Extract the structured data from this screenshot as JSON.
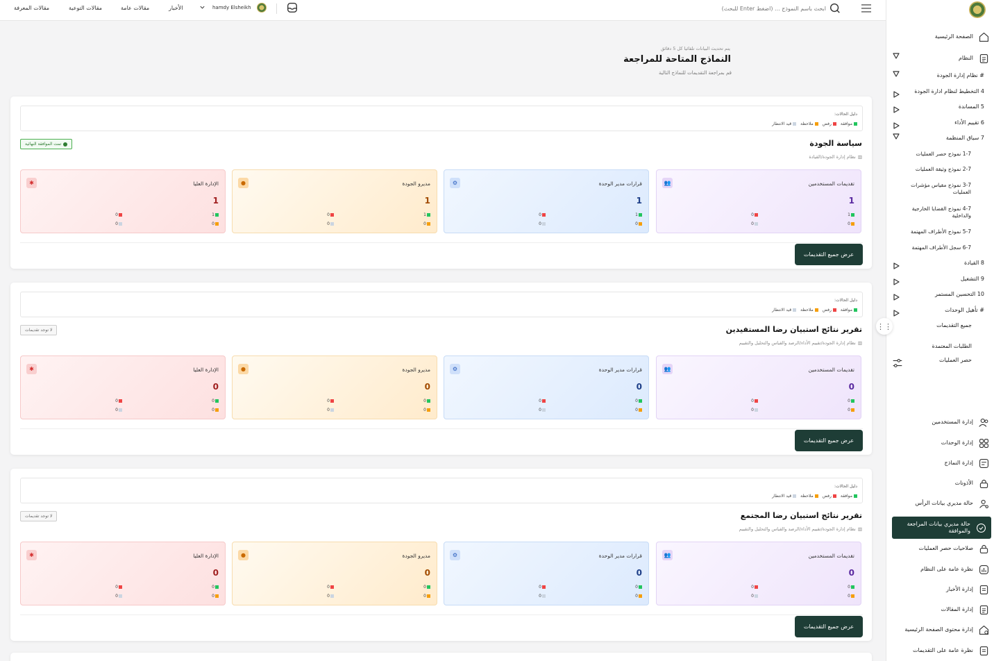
{
  "topbar": {
    "links": [
      "مقالات المعرفة",
      "مقالات التوعية",
      "مقالات عامة",
      "الأخبار"
    ],
    "user_name": "hamdy Elsheikh",
    "search_placeholder": "ابحث باسم النموذج ... (اضغط Enter للبحث)"
  },
  "header": {
    "update_note": "يتم تحديث البيانات تلقائيا كل 5 دقائق",
    "title": "النماذج المتاحة للمراجعة",
    "subtitle": "قم بمراجعة التقديمات للنماذج التالية"
  },
  "legend": {
    "title": "دليل الحالات:",
    "items": [
      {
        "label": "موافقة",
        "color": "#22c55e"
      },
      {
        "label": "رفض",
        "color": "#ef4444"
      },
      {
        "label": "ملاحظة",
        "color": "#f59e0b"
      },
      {
        "label": "قيد الانتظار",
        "color": "#cbd5e1"
      }
    ]
  },
  "tile_labels": [
    "تقديمات المستخدمين",
    "قرارات مدير الوحدة",
    "مديرو الجودة",
    "الإدارة العليا"
  ],
  "button_label": "عرض جميع التقديمات",
  "cards": [
    {
      "title": "سياسة الجودة",
      "path": "نظام إدارة الجودة/القيادة",
      "badge": "تمت الموافقة النهائية",
      "badge_type": "ok",
      "tiles": [
        {
          "value": "1",
          "approve": "1",
          "reject": "0",
          "note": "0",
          "pending": "0"
        },
        {
          "value": "1",
          "approve": "1",
          "reject": "0",
          "note": "0",
          "pending": "0"
        },
        {
          "value": "1",
          "approve": "1",
          "reject": "0",
          "note": "0",
          "pending": "0"
        },
        {
          "value": "1",
          "approve": "1",
          "reject": "0",
          "note": "0",
          "pending": "0"
        }
      ]
    },
    {
      "title": "تقرير نتائج استبيان رضا المستفيدين",
      "path": "نظام إدارة الجودة/تقييم الأداء/الرصد والقياس والتحليل والتقييم",
      "badge": "لا توجد تقديمات",
      "badge_type": "none",
      "tiles": [
        {
          "value": "0",
          "approve": "0",
          "reject": "0",
          "note": "0",
          "pending": "0"
        },
        {
          "value": "0",
          "approve": "0",
          "reject": "0",
          "note": "0",
          "pending": "0"
        },
        {
          "value": "0",
          "approve": "0",
          "reject": "0",
          "note": "0",
          "pending": "0"
        },
        {
          "value": "0",
          "approve": "0",
          "reject": "0",
          "note": "0",
          "pending": "0"
        }
      ]
    },
    {
      "title": "تقرير نتائج استبيان رضا المجتمع",
      "path": "نظام إدارة الجودة/تقييم الأداء/الرصد والقياس والتحليل والتقييم",
      "badge": "لا توجد تقديمات",
      "badge_type": "none",
      "tiles": [
        {
          "value": "0",
          "approve": "0",
          "reject": "0",
          "note": "0",
          "pending": "0"
        },
        {
          "value": "0",
          "approve": "0",
          "reject": "0",
          "note": "0",
          "pending": "0"
        },
        {
          "value": "0",
          "approve": "0",
          "reject": "0",
          "note": "0",
          "pending": "0"
        },
        {
          "value": "0",
          "approve": "0",
          "reject": "0",
          "note": "0",
          "pending": "0"
        }
      ]
    }
  ],
  "sidebar": {
    "home": "الصفحة الرئيسية",
    "system": "النظام",
    "sections": [
      "# نظام إدارة الجودة",
      "4 التخطيط لنظام ادارة الجودة",
      "5 المساندة",
      "6 تقييم الأداء",
      "7 سياق المنظمة"
    ],
    "sub_items": [
      "1-7 نموذج حصر العمليات",
      "2-7 نموذج وثيقة العمليات",
      "3-7 نموذج مقياس مؤشرات العمليات",
      "4-7 نموذج القضايا الخارجية والداخلية",
      "5-7 نموذج الأطراف المهتمة",
      "6-7 سجل الأطراف المهتمة"
    ],
    "sections2": [
      "8 القيادة",
      "9 التشغيل",
      "10 التحسين المستمر",
      "# تأهيل الوحدات"
    ],
    "all_submissions": "جميع التقديمات",
    "approved_requests": "الطلبات المعتمدة",
    "process_inventory": "حصر العمليات",
    "admin": [
      "إدارة المستخدمين",
      "إدارة الوحدات",
      "إدارة النماذج",
      "الأذونات",
      "حالة مديري بيانات الرأس",
      "حالة مديري بيانات المراجعة والموافقة",
      "صلاحيات حصر العمليات",
      "نظرة عامة على النظام",
      "إدارة الأخبار",
      "إدارة المقالات",
      "إدارة محتوى الصفحة الرئيسية",
      "نظرة عامة على التقديمات"
    ]
  }
}
